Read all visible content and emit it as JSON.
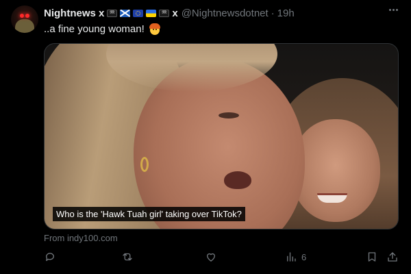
{
  "tweet": {
    "author": {
      "display_name": "Nightnews x",
      "name_suffix": "x",
      "flags": [
        "jolly-roger",
        "scotland",
        "european-union",
        "ukraine",
        "jolly-roger"
      ],
      "handle": "@Nightnewsdotnet",
      "separator": "·",
      "time": "19h"
    },
    "text": "..a fine young woman!",
    "text_emoji": "face-with-cowboy-hat",
    "media": {
      "type": "video",
      "caption": "Who is the 'Hawk Tuah girl' taking over TikTok?"
    },
    "source_label": "From indy100.com",
    "actions": {
      "reply_icon": "reply-icon",
      "retweet_icon": "retweet-icon",
      "like_icon": "heart-icon",
      "views_icon": "views-icon",
      "views_count": "6",
      "bookmark_icon": "bookmark-icon",
      "share_icon": "share-icon"
    }
  },
  "colors": {
    "background": "#000000",
    "text_primary": "#e7e9ea",
    "text_secondary": "#71767b",
    "border": "#2f3336"
  }
}
